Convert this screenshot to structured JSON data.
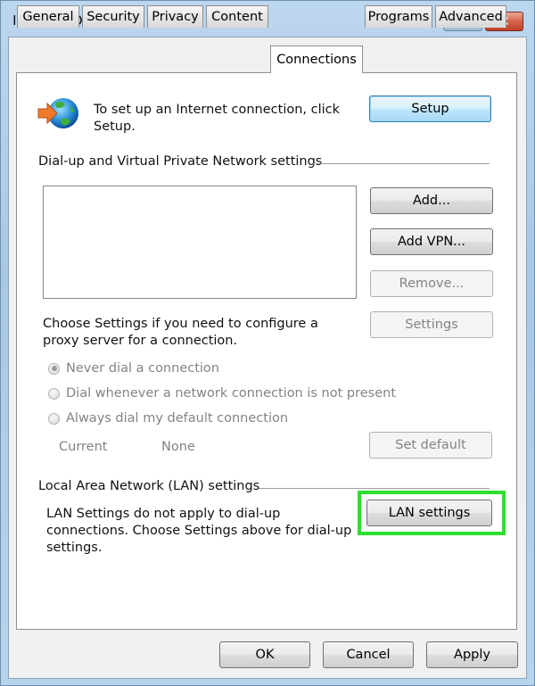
{
  "window": {
    "title": "Internet Options",
    "help_label": "?",
    "close_label": "✕"
  },
  "tabs": [
    {
      "label": "General",
      "active": false
    },
    {
      "label": "Security",
      "active": false
    },
    {
      "label": "Privacy",
      "active": false
    },
    {
      "label": "Content",
      "active": false
    },
    {
      "label": "Connections",
      "active": true
    },
    {
      "label": "Programs",
      "active": false
    },
    {
      "label": "Advanced",
      "active": false
    }
  ],
  "setup": {
    "icon": "globe-with-arrow-icon",
    "text": "To set up an Internet connection, click Setup.",
    "button": "Setup"
  },
  "dialup": {
    "group_label": "Dial-up and Virtual Private Network settings",
    "connections_list": [],
    "buttons": {
      "add": "Add...",
      "add_vpn": "Add VPN...",
      "remove": "Remove...",
      "settings": "Settings"
    },
    "proxy_text": "Choose Settings if you need to configure a proxy server for a connection.",
    "radios": [
      {
        "label": "Never dial a connection",
        "checked": true
      },
      {
        "label": "Dial whenever a network connection is not present",
        "checked": false
      },
      {
        "label": "Always dial my default connection",
        "checked": false
      }
    ],
    "current_label": "Current",
    "current_value": "None",
    "set_default": "Set default"
  },
  "lan": {
    "group_label": "Local Area Network (LAN) settings",
    "text": "LAN Settings do not apply to dial-up connections. Choose Settings above for dial-up settings.",
    "button": "LAN settings",
    "highlight_color": "#2ce12c"
  },
  "footer": {
    "ok": "OK",
    "cancel": "Cancel",
    "apply": "Apply"
  }
}
